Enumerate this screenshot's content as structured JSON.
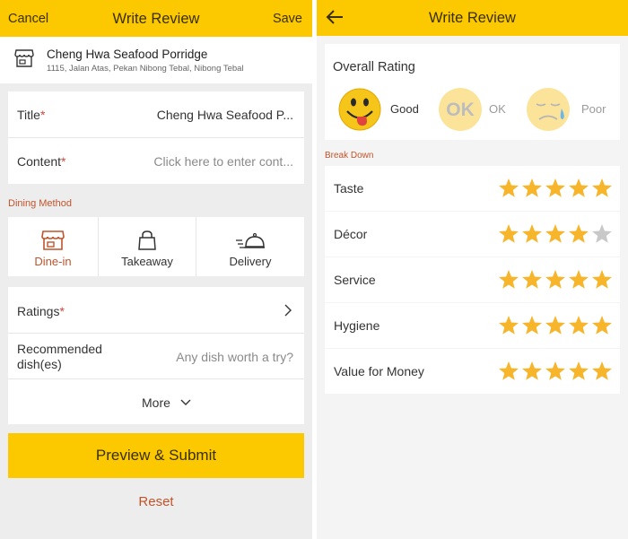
{
  "left": {
    "header": {
      "cancel": "Cancel",
      "title": "Write Review",
      "save": "Save"
    },
    "restaurant": {
      "name": "Cheng Hwa Seafood Porridge",
      "address": "1115, Jalan Atas, Pekan Nibong Tebal, Nibong Tebal"
    },
    "form": {
      "title_label": "Title",
      "title_value": "Cheng  Hwa  Seafood  P...",
      "content_label": "Content",
      "content_placeholder": "Click here to enter cont...",
      "required_mark": "*"
    },
    "dining": {
      "section_label": "Dining Method",
      "options": [
        {
          "label": "Dine-in",
          "icon": "store-icon",
          "selected": true
        },
        {
          "label": "Takeaway",
          "icon": "bag-icon",
          "selected": false
        },
        {
          "label": "Delivery",
          "icon": "food-cloche-icon",
          "selected": false
        }
      ]
    },
    "ratings_label": "Ratings",
    "recommended_label_line1": "Recommended",
    "recommended_label_line2": "dish(es)",
    "recommended_placeholder": "Any dish worth a try?",
    "more_label": "More",
    "submit_label": "Preview & Submit",
    "reset_label": "Reset"
  },
  "right": {
    "header": {
      "title": "Write Review"
    },
    "overall": {
      "title": "Overall Rating",
      "options": [
        {
          "label": "Good",
          "icon": "happy-face-icon",
          "selected": true
        },
        {
          "label": "OK",
          "face_text": "OK",
          "icon": "ok-face-icon",
          "selected": false
        },
        {
          "label": "Poor",
          "icon": "sad-face-icon",
          "selected": false
        }
      ]
    },
    "breakdown_label": "Break Down",
    "categories": [
      {
        "label": "Taste",
        "stars": 5
      },
      {
        "label": "Décor",
        "stars": 4
      },
      {
        "label": "Service",
        "stars": 5
      },
      {
        "label": "Hygiene",
        "stars": 5
      },
      {
        "label": "Value for Money",
        "stars": 5
      }
    ],
    "max_stars": 5
  },
  "colors": {
    "accent": "#fcc900",
    "label_red": "#c0542c",
    "star_on": "#f6b52b",
    "star_off": "#c8c8c8"
  }
}
